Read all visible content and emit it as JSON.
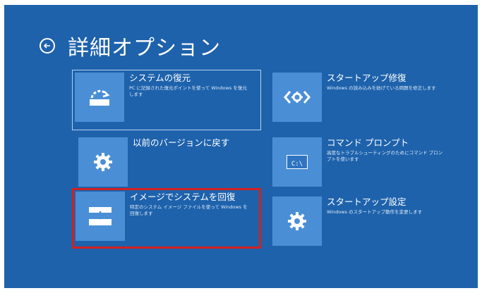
{
  "header": {
    "title": "詳細オプション"
  },
  "options": [
    {
      "label": "システムの復元",
      "desc": "PC に記録された復元ポイントを使って Windows を復元します"
    },
    {
      "label": "スタートアップ修復",
      "desc": "Windows の読み込みを妨げている問題を修正します"
    },
    {
      "label": "以前のバージョンに戻す",
      "desc": ""
    },
    {
      "label": "コマンド プロンプト",
      "desc": "高度なトラブルシューティングのためにコマンド プロンプトを使います"
    },
    {
      "label": "イメージでシステムを回復",
      "desc": "特定のシステム イメージ ファイルを使って Windows を回復します"
    },
    {
      "label": "スタートアップ設定",
      "desc": "Windows のスタートアップ動作を変更します"
    }
  ],
  "icons": {
    "cmd_text": "C:\\",
    "tile_color": "#4a8fd6",
    "background_color": "#1e62ac",
    "highlight_color": "#d4201f"
  }
}
